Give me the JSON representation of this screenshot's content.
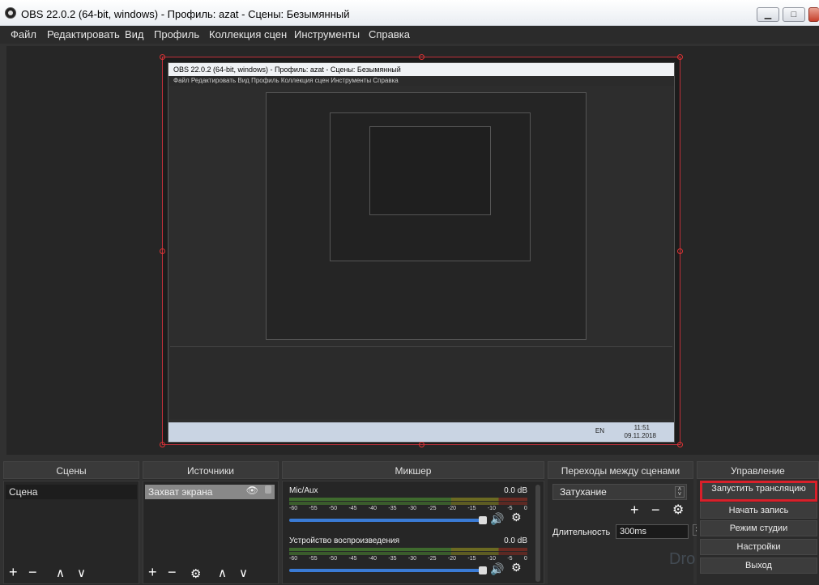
{
  "window": {
    "title": "OBS 22.0.2 (64-bit, windows) - Профиль: azat - Сцены: Безымянный",
    "minimize": "▁",
    "maximize": "□",
    "close": "✕"
  },
  "menu": [
    "Файл",
    "Редактировать",
    "Вид",
    "Профиль",
    "Коллекция сцен",
    "Инструменты",
    "Справка"
  ],
  "preview": {
    "nested_title": "OBS 22.0.2 (64-bit, windows) - Профиль: azat - Сцены: Безымянный",
    "nested_menu": "Файл  Редактировать  Вид  Профиль  Коллекция сцен  Инструменты  Справка",
    "nested_time": "11:51",
    "nested_date": "09.11.2018",
    "nested_lang": "EN"
  },
  "scenes": {
    "header": "Сцены",
    "items": [
      "Сцена"
    ]
  },
  "sources": {
    "header": "Источники",
    "items": [
      "Захват экрана"
    ]
  },
  "mixer": {
    "header": "Микшер",
    "channels": [
      {
        "name": "Mic/Aux",
        "db": "0.0 dB",
        "level": 1.0
      },
      {
        "name": "Устройство воспроизведения",
        "db": "0.0 dB",
        "level": 1.0
      }
    ],
    "ticks": [
      "-60",
      "-55",
      "-50",
      "-45",
      "-40",
      "-35",
      "-30",
      "-25",
      "-20",
      "-15",
      "-10",
      "-5",
      "0"
    ]
  },
  "transitions": {
    "header": "Переходы между сценами",
    "selected": "Затухание",
    "duration_label": "Длительность",
    "duration_value": "300ms"
  },
  "controls": {
    "header": "Управление",
    "buttons": [
      "Запустить трансляцию",
      "Начать запись",
      "Режим студии",
      "Настройки",
      "Выход"
    ]
  },
  "toolbar": {
    "add": "+",
    "remove": "−",
    "up": "∧",
    "down": "∨",
    "gear": "⚙"
  },
  "watermark": "Dro"
}
